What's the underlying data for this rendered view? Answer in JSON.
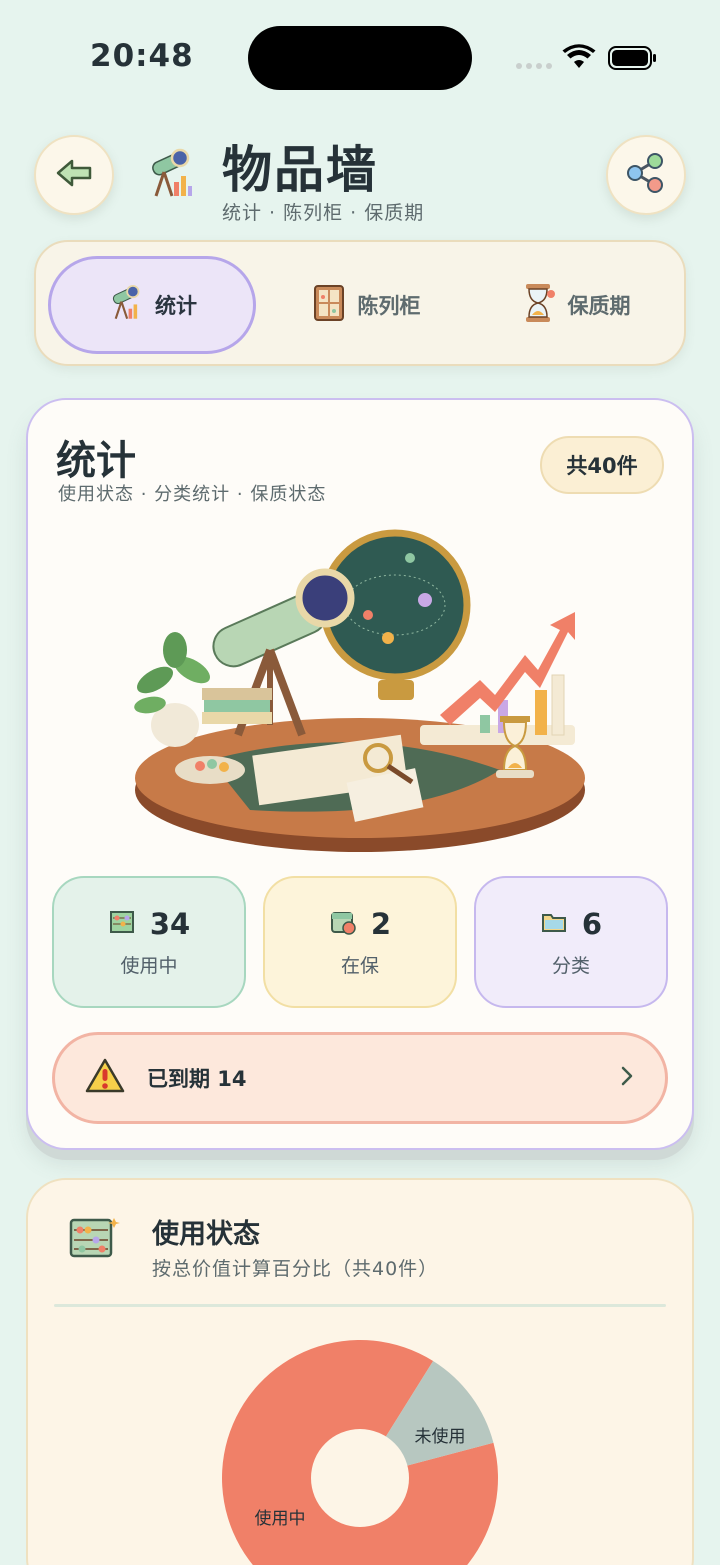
{
  "status_bar": {
    "time": "20:48"
  },
  "header": {
    "title": "物品墙",
    "subtitle": "统计 · 陈列柜 · 保质期"
  },
  "tabs": [
    {
      "label": "统计",
      "icon": "telescope-chart-icon",
      "active": true
    },
    {
      "label": "陈列柜",
      "icon": "cabinet-icon",
      "active": false
    },
    {
      "label": "保质期",
      "icon": "hourglass-icon",
      "active": false
    }
  ],
  "stats_card": {
    "title": "统计",
    "subtitle": "使用状态 · 分类统计 · 保质状态",
    "total_badge": "共40件",
    "stats": [
      {
        "value": "34",
        "label": "使用中",
        "icon": "abacus-icon"
      },
      {
        "value": "2",
        "label": "在保",
        "icon": "warranty-calendar-icon"
      },
      {
        "value": "6",
        "label": "分类",
        "icon": "folder-icon"
      }
    ],
    "expired_label": "已到期 14"
  },
  "usage_card": {
    "title": "使用状态",
    "subtitle": "按总价值计算百分比（共40件）"
  },
  "chart_data": {
    "type": "pie",
    "categories": [
      "使用中",
      "未使用"
    ],
    "values": [
      88,
      12
    ],
    "colors": [
      "#f08068",
      "#b7c7c0"
    ]
  },
  "colors": {
    "accent": "#b6a6ea",
    "background": "#e6f4ee"
  }
}
